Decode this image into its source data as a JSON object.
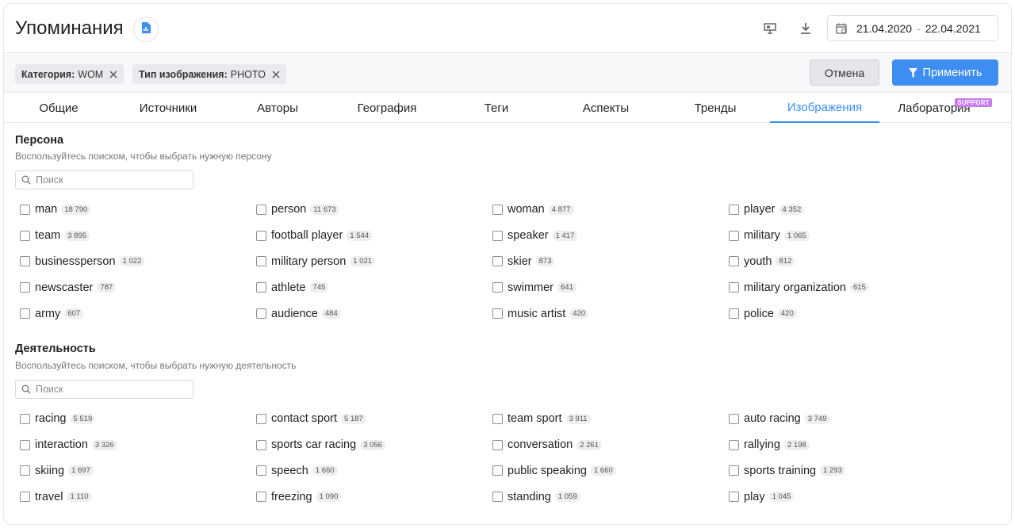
{
  "header": {
    "title": "Упоминания",
    "date_from": "21.04.2020",
    "date_sep": "-",
    "date_to": "22.04.2021"
  },
  "filters": {
    "chips": [
      {
        "key": "Категория:",
        "value": "WOM"
      },
      {
        "key": "Тип изображения:",
        "value": "PHOTO"
      }
    ],
    "cancel_label": "Отмена",
    "apply_label": "Применить"
  },
  "tabs": [
    {
      "label": "Общие"
    },
    {
      "label": "Источники"
    },
    {
      "label": "Авторы"
    },
    {
      "label": "География"
    },
    {
      "label": "Теги"
    },
    {
      "label": "Аспекты"
    },
    {
      "label": "Тренды"
    },
    {
      "label": "Изображения"
    },
    {
      "label": "Лаборатория",
      "badge": "SUPPORT"
    }
  ],
  "persona": {
    "title": "Персона",
    "desc": "Воспользуйтесь поиском, чтобы выбрать нужную персону",
    "search_placeholder": "Поиск",
    "items": [
      {
        "label": "man",
        "count": "18 790"
      },
      {
        "label": "person",
        "count": "11 673"
      },
      {
        "label": "woman",
        "count": "4 877"
      },
      {
        "label": "player",
        "count": "4 352"
      },
      {
        "label": "team",
        "count": "3 895"
      },
      {
        "label": "football player",
        "count": "1 544"
      },
      {
        "label": "speaker",
        "count": "1 417"
      },
      {
        "label": "military",
        "count": "1 065"
      },
      {
        "label": "businessperson",
        "count": "1 022"
      },
      {
        "label": "military person",
        "count": "1 021"
      },
      {
        "label": "skier",
        "count": "873"
      },
      {
        "label": "youth",
        "count": "812"
      },
      {
        "label": "newscaster",
        "count": "787"
      },
      {
        "label": "athlete",
        "count": "745"
      },
      {
        "label": "swimmer",
        "count": "641"
      },
      {
        "label": "military organization",
        "count": "615"
      },
      {
        "label": "army",
        "count": "607"
      },
      {
        "label": "audience",
        "count": "484"
      },
      {
        "label": "music artist",
        "count": "420"
      },
      {
        "label": "police",
        "count": "420"
      }
    ]
  },
  "activity": {
    "title": "Деятельность",
    "desc": "Воспользуйтесь поиском, чтобы выбрать нужную деятельность",
    "search_placeholder": "Поиск",
    "items": [
      {
        "label": "racing",
        "count": "5 519"
      },
      {
        "label": "contact sport",
        "count": "5 187"
      },
      {
        "label": "team sport",
        "count": "3 911"
      },
      {
        "label": "auto racing",
        "count": "3 749"
      },
      {
        "label": "interaction",
        "count": "3 326"
      },
      {
        "label": "sports car racing",
        "count": "3 056"
      },
      {
        "label": "conversation",
        "count": "2 261"
      },
      {
        "label": "rallying",
        "count": "2 198"
      },
      {
        "label": "skiing",
        "count": "1 697"
      },
      {
        "label": "speech",
        "count": "1 660"
      },
      {
        "label": "public speaking",
        "count": "1 660"
      },
      {
        "label": "sports training",
        "count": "1 293"
      },
      {
        "label": "travel",
        "count": "1 110"
      },
      {
        "label": "freezing",
        "count": "1 090"
      },
      {
        "label": "standing",
        "count": "1 059"
      },
      {
        "label": "play",
        "count": "1 045"
      }
    ]
  },
  "colors": {
    "accent": "#3d8ef0",
    "support_badge": "#c77cf2"
  },
  "icons": {
    "report": "report-document-icon",
    "presentation": "presentation-icon",
    "download": "download-icon",
    "calendar": "calendar-icon",
    "close": "close-icon",
    "filter": "filter-icon",
    "search": "search-icon"
  }
}
